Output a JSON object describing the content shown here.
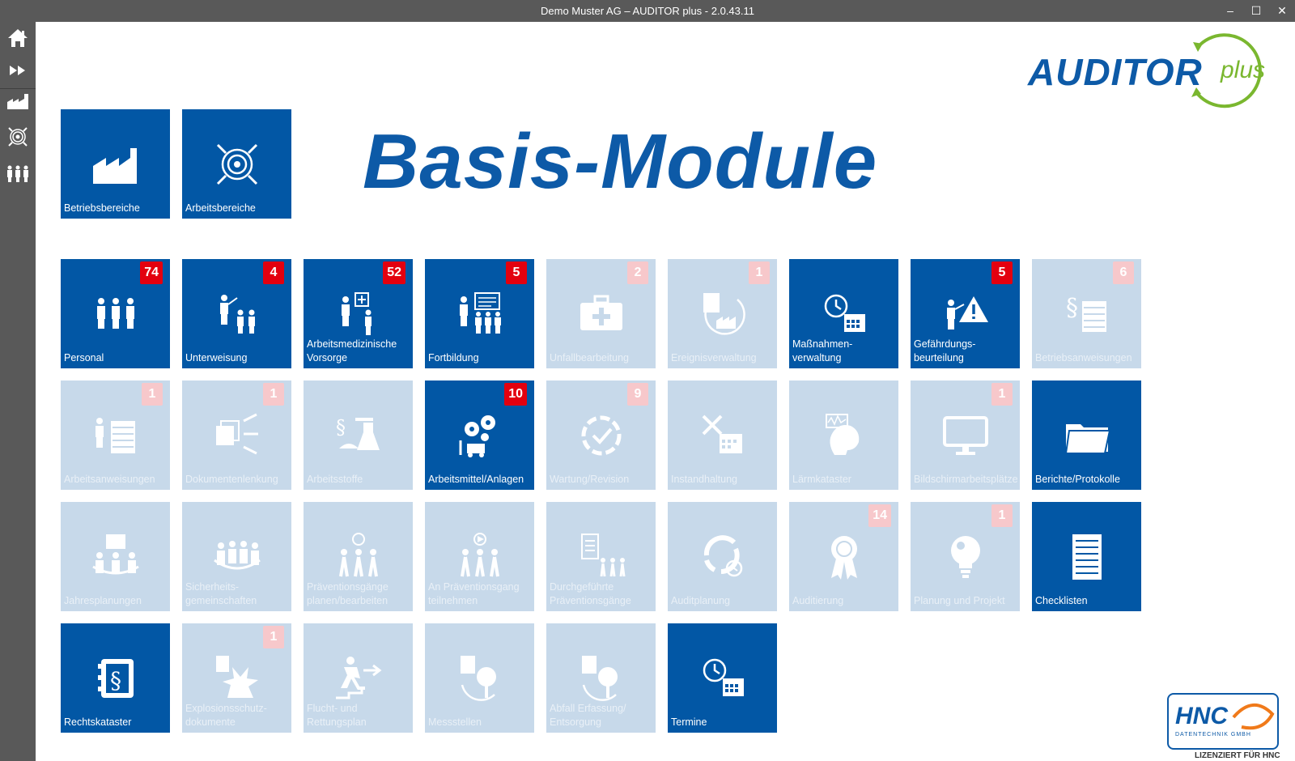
{
  "window": {
    "title": "Demo Muster AG – AUDITOR plus - 2.0.43.11",
    "minimize": "–",
    "maximize": "☐",
    "close": "✕"
  },
  "sidebar": {
    "items": [
      {
        "icon": "home-icon"
      },
      {
        "icon": "fast-forward-icon"
      },
      {
        "icon": "factory-icon"
      },
      {
        "icon": "target-icon"
      },
      {
        "icon": "people-icon"
      }
    ]
  },
  "brand": {
    "auditor": "AUDITOR",
    "plus": "plus",
    "accent": "#7ab72f",
    "primary": "#0d5aa7"
  },
  "heading": "Basis-Module",
  "top_tiles": [
    {
      "label": "Betriebsbereiche",
      "icon": "factory-icon"
    },
    {
      "label": "Arbeitsbereiche",
      "icon": "target-icon"
    }
  ],
  "tiles": [
    {
      "label": "Personal",
      "badge": "74",
      "active": true,
      "icon": "people-icon"
    },
    {
      "label": "Unterweisung",
      "badge": "4",
      "active": true,
      "icon": "instruction-icon"
    },
    {
      "label": "Arbeitsmedizinische\nVorsorge",
      "badge": "52",
      "active": true,
      "icon": "medical-care-icon"
    },
    {
      "label": "Fortbildung",
      "badge": "5",
      "active": true,
      "icon": "training-icon"
    },
    {
      "label": "Unfallbearbeitung",
      "badge": "2",
      "active": false,
      "icon": "first-aid-icon"
    },
    {
      "label": "Ereignisverwaltung",
      "badge": "1",
      "active": false,
      "icon": "event-icon"
    },
    {
      "label": "Maßnahmen-\nverwaltung",
      "badge": "",
      "active": true,
      "icon": "clock-calendar-icon"
    },
    {
      "label": "Gefährdungs-\nbeurteilung",
      "badge": "5",
      "active": true,
      "icon": "warning-icon"
    },
    {
      "label": "Betriebsanweisungen",
      "badge": "6",
      "active": false,
      "icon": "paragraph-document-icon"
    },
    {
      "label": "Arbeitsanweisungen",
      "badge": "1",
      "active": false,
      "icon": "work-instruction-icon"
    },
    {
      "label": "Dokumentenlenkung",
      "badge": "1",
      "active": false,
      "icon": "document-control-icon"
    },
    {
      "label": "Arbeitsstoffe",
      "badge": "",
      "active": false,
      "icon": "hazardous-substance-icon"
    },
    {
      "label": "Arbeitsmittel/Anlagen",
      "badge": "10",
      "active": true,
      "icon": "gears-icon"
    },
    {
      "label": "Wartung/Revision",
      "badge": "9",
      "active": false,
      "icon": "maintenance-cycle-icon"
    },
    {
      "label": "Instandhaltung",
      "badge": "",
      "active": false,
      "icon": "tools-calendar-icon"
    },
    {
      "label": "Lärmkataster",
      "badge": "",
      "active": false,
      "icon": "noise-icon"
    },
    {
      "label": "Bildschirmarbeitsplätze",
      "badge": "1",
      "active": false,
      "icon": "monitor-icon"
    },
    {
      "label": "Berichte/Protokolle",
      "badge": "",
      "active": true,
      "icon": "folder-icon"
    },
    {
      "label": "Jahresplanungen",
      "badge": "",
      "active": false,
      "icon": "meeting-calendar-icon"
    },
    {
      "label": "Sicherheits-\ngemeinschaften",
      "badge": "",
      "active": false,
      "icon": "team-icon"
    },
    {
      "label": "Präventionsgänge\nplanen/bearbeiten",
      "badge": "",
      "active": false,
      "icon": "walk-clock-icon"
    },
    {
      "label": "An Präventionsgang\nteilnehmen",
      "badge": "",
      "active": false,
      "icon": "walk-play-icon"
    },
    {
      "label": "Durchgeführte\nPräventionsgänge",
      "badge": "",
      "active": false,
      "icon": "walk-list-icon"
    },
    {
      "label": "Auditplanung",
      "badge": "",
      "active": false,
      "icon": "audit-cycle-icon"
    },
    {
      "label": "Auditierung",
      "badge": "14",
      "active": false,
      "icon": "award-icon"
    },
    {
      "label": "Planung und Projekt",
      "badge": "1",
      "active": false,
      "icon": "lightbulb-icon"
    },
    {
      "label": "Checklisten",
      "badge": "",
      "active": true,
      "icon": "checklist-icon"
    },
    {
      "label": "Rechtskataster",
      "badge": "",
      "active": true,
      "icon": "law-book-icon"
    },
    {
      "label": "Explosionsschutz-\ndokumente",
      "badge": "1",
      "active": false,
      "icon": "explosion-icon"
    },
    {
      "label": "Flucht- und\nRettungsplan",
      "badge": "",
      "active": false,
      "icon": "escape-icon"
    },
    {
      "label": "Messstellen",
      "badge": "",
      "active": false,
      "icon": "measurement-icon"
    },
    {
      "label": "Abfall Erfassung/\nEntsorgung",
      "badge": "",
      "active": false,
      "icon": "waste-icon"
    },
    {
      "label": "Termine",
      "badge": "",
      "active": true,
      "icon": "clock-calendar-icon"
    }
  ],
  "license": {
    "logo": "HNC",
    "sub": "DATENTECHNIK GMBH",
    "text": "LIZENZIERT FÜR HNC"
  }
}
